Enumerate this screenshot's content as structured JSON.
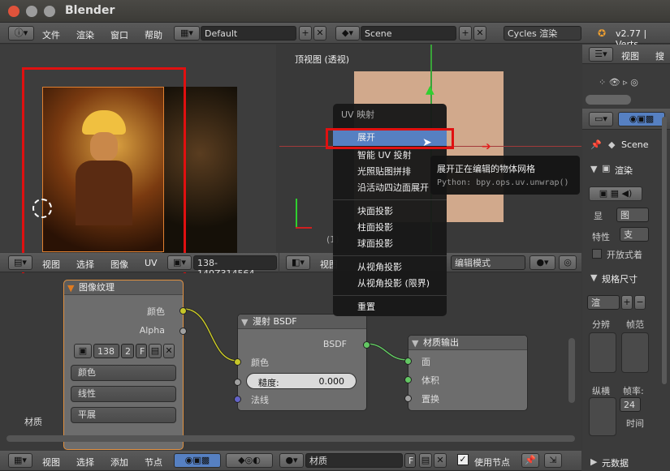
{
  "window": {
    "title": "Blender"
  },
  "info": {
    "menus": [
      "文件",
      "渲染",
      "窗口",
      "帮助"
    ],
    "layout": "Default",
    "scene": "Scene",
    "engine": "Cycles 渲染",
    "version": "v2.77 | Verts"
  },
  "uv_editor": {
    "menus": [
      "视图",
      "选择",
      "图像",
      "UV"
    ],
    "image_name": "138-140Z314564"
  },
  "view3d": {
    "label": "顶视图 (透视)",
    "menus": [
      "视图"
    ],
    "mode": "编辑模式",
    "select_partial": "选",
    "frame_partial": "(1)"
  },
  "uv_menu": {
    "title": "UV 映射",
    "items": [
      "展开",
      "智能 UV 投射",
      "光照贴图拼排",
      "沿活动四边面展开",
      "块面投影",
      "柱面投影",
      "球面投影",
      "从视角投影",
      "从视角投影 (限界)",
      "重置"
    ],
    "highlighted": "展开"
  },
  "tooltip": {
    "text": "展开正在编辑的物体网格",
    "python": "Python: bpy.ops.uv.unwrap()"
  },
  "nodes": {
    "image": {
      "title": "图像纹理",
      "outputs": [
        "颜色",
        "Alpha"
      ],
      "num": "138",
      "users": "2",
      "fake": "F",
      "options": [
        "颜色",
        "线性",
        "平展"
      ]
    },
    "bsdf": {
      "title": "漫射 BSDF",
      "output": "BSDF",
      "inputs": [
        "颜色",
        "法线"
      ],
      "roughness_label": "糙度:",
      "roughness_value": "0.000"
    },
    "output": {
      "title": "材质输出",
      "inputs": [
        "面",
        "体积",
        "置换"
      ]
    }
  },
  "node_editor": {
    "label": "材质",
    "menus": [
      "视图",
      "选择",
      "添加",
      "节点"
    ],
    "material": "材质",
    "fake": "F",
    "use_nodes": "使用节点"
  },
  "outliner": {
    "menus": [
      "视图",
      "搜"
    ]
  },
  "properties": {
    "scene": "Scene",
    "render_label": "渲染",
    "display_label": "显",
    "display_value": "图",
    "feature_label": "特性",
    "feature_value": "支",
    "open_shading": "开放式着",
    "dims_label": "规格尺寸",
    "render_preset": "渲",
    "resolution": "分辨",
    "frame_rate_label": "帧率:",
    "frame_rate_value": "24",
    "aspect": "帧范",
    "frame_aspect": "纵横",
    "time_label": "时间",
    "metadata": "元数据"
  },
  "colors": {
    "accent": "#5680c2",
    "highlight_box": "#e01010",
    "node_yellow": "#c7c729",
    "node_grey": "#a1a1a1",
    "node_blue": "#6363c7",
    "node_green": "#63c763"
  }
}
